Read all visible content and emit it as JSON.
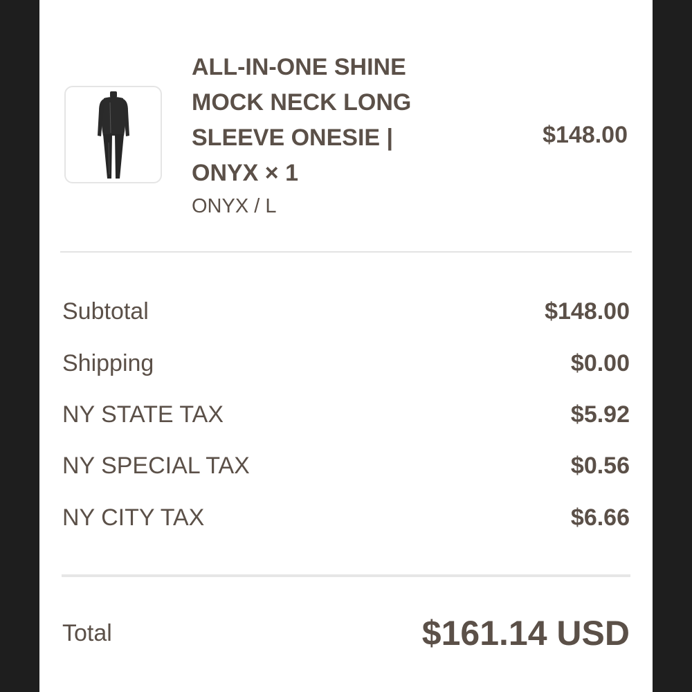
{
  "product": {
    "title": "ALL-IN-ONE SHINE MOCK NECK LONG SLEEVE ONESIE | ONYX × 1",
    "variant": "ONYX / L",
    "price": "$148.00",
    "image_icon": "onesie-image"
  },
  "summary": {
    "rows": [
      {
        "label": "Subtotal",
        "value": "$148.00"
      },
      {
        "label": "Shipping",
        "value": "$0.00"
      },
      {
        "label": "NY STATE TAX",
        "value": "$5.92"
      },
      {
        "label": "NY SPECIAL TAX",
        "value": "$0.56"
      },
      {
        "label": "NY CITY TAX",
        "value": "$6.66"
      }
    ],
    "total_label": "Total",
    "total_value": "$161.14 USD"
  },
  "colors": {
    "text": "#5b5048",
    "background": "#ffffff",
    "outer": "#1e1e1e",
    "divider": "#e3e3e3"
  }
}
